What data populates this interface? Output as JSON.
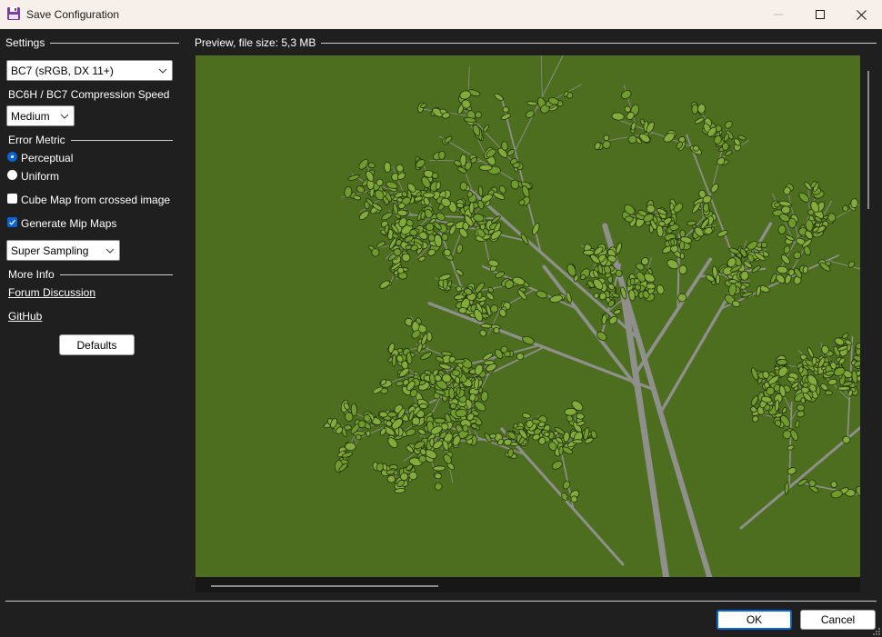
{
  "window": {
    "title": "Save Configuration",
    "icon": "floppy-disk-icon",
    "controls": [
      "minimize-icon",
      "maximize-icon",
      "close-icon"
    ]
  },
  "settings": {
    "header": "Settings",
    "format": {
      "value": "BC7 (sRGB, DX 11+)"
    },
    "speed": {
      "label": "BC6H / BC7 Compression Speed",
      "value": "Medium"
    },
    "error_metric": {
      "label": "Error Metric",
      "options": [
        {
          "label": "Perceptual",
          "checked": true
        },
        {
          "label": "Uniform",
          "checked": false
        }
      ]
    },
    "cube_map": {
      "label": "Cube Map from crossed image",
      "checked": false
    },
    "mip_maps": {
      "label": "Generate Mip Maps",
      "checked": true
    },
    "mip_filter": {
      "value": "Super Sampling"
    },
    "more_info": {
      "label": "More Info",
      "links": [
        "Forum Discussion",
        "GitHub"
      ]
    },
    "defaults_label": "Defaults"
  },
  "preview": {
    "header": "Preview, file size: 5,3 MB",
    "background_color": "#4d6e1f",
    "subject": "tree-foliage-texture"
  },
  "footer": {
    "ok_label": "OK",
    "cancel_label": "Cancel"
  },
  "colors": {
    "titlebar": "#f7efe9",
    "panel": "#1f1f1f",
    "accent": "#0a64d6",
    "preview_bg": "#4d6e1f"
  }
}
